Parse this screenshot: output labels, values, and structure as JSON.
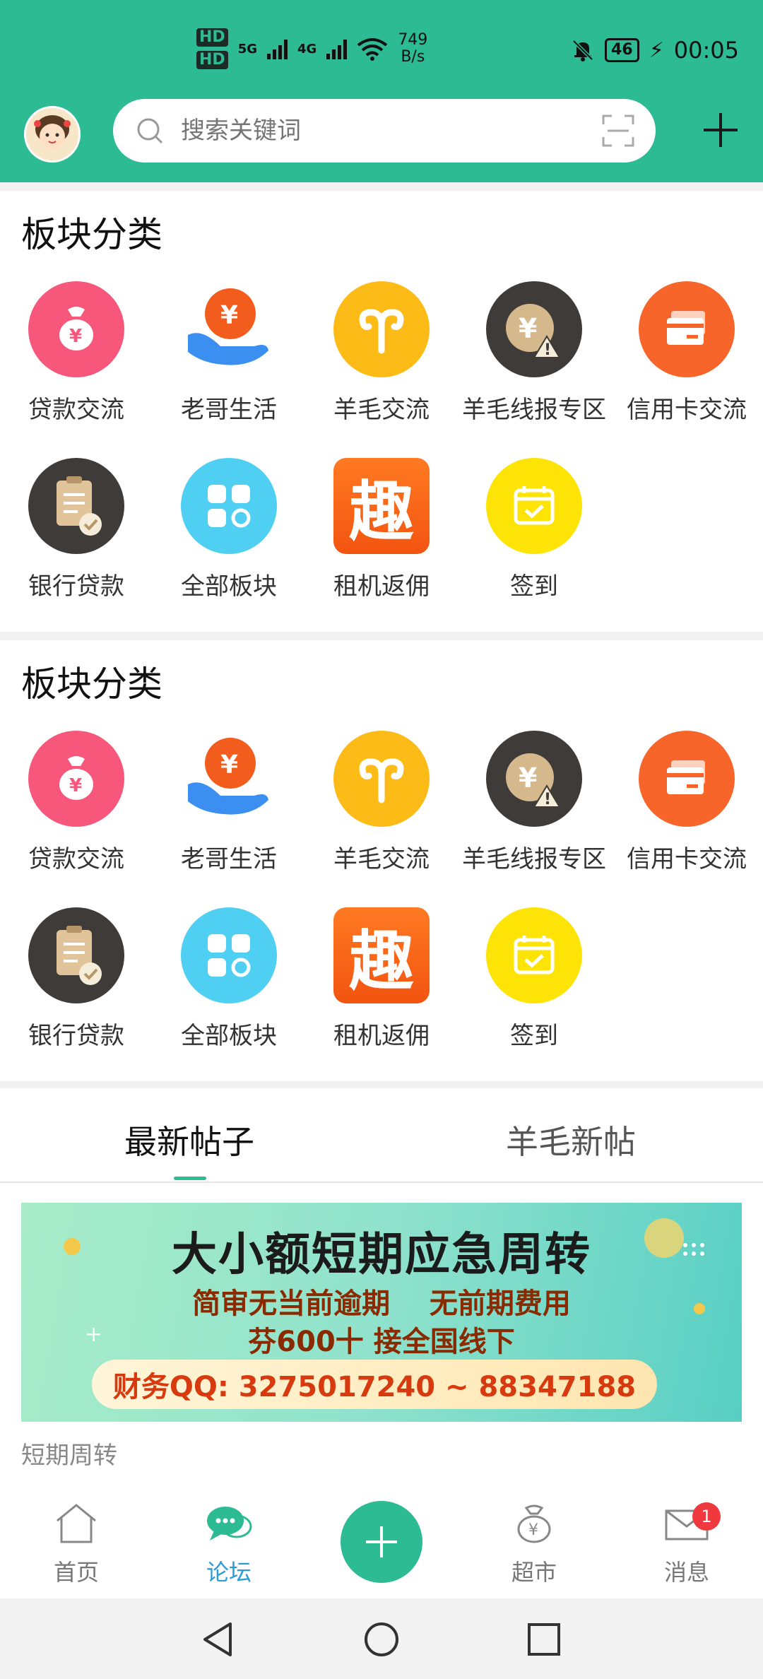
{
  "status_bar": {
    "hd1": "HD",
    "hd2": "HD",
    "net1": "5G",
    "net2": "4G",
    "speed_value": "749",
    "speed_unit": "B/s",
    "battery": "46",
    "time": "00:05"
  },
  "header": {
    "search_placeholder": "搜索关键词"
  },
  "sections": [
    {
      "title": "板块分类",
      "items": [
        {
          "label": "贷款交流",
          "icon": "money-bag-icon"
        },
        {
          "label": "老哥生活",
          "icon": "hand-coin-icon"
        },
        {
          "label": "羊毛交流",
          "icon": "aries-icon"
        },
        {
          "label": "羊毛线报专区",
          "icon": "coin-warning-icon"
        },
        {
          "label": "信用卡交流",
          "icon": "credit-card-icon"
        },
        {
          "label": "银行贷款",
          "icon": "clipboard-check-icon"
        },
        {
          "label": "全部板块",
          "icon": "all-blocks-icon"
        },
        {
          "label": "租机返佣",
          "icon": "qu-char-icon",
          "glyph": "趣"
        },
        {
          "label": "签到",
          "icon": "calendar-check-icon"
        }
      ]
    },
    {
      "title": "板块分类",
      "items": [
        {
          "label": "贷款交流",
          "icon": "money-bag-icon"
        },
        {
          "label": "老哥生活",
          "icon": "hand-coin-icon"
        },
        {
          "label": "羊毛交流",
          "icon": "aries-icon"
        },
        {
          "label": "羊毛线报专区",
          "icon": "coin-warning-icon"
        },
        {
          "label": "信用卡交流",
          "icon": "credit-card-icon"
        },
        {
          "label": "银行贷款",
          "icon": "clipboard-check-icon"
        },
        {
          "label": "全部板块",
          "icon": "all-blocks-icon"
        },
        {
          "label": "租机返佣",
          "icon": "qu-char-icon",
          "glyph": "趣"
        },
        {
          "label": "签到",
          "icon": "calendar-check-icon"
        }
      ]
    }
  ],
  "tabs": [
    {
      "label": "最新帖子",
      "active": true
    },
    {
      "label": "羊毛新帖",
      "active": false
    }
  ],
  "post": {
    "banner_line1": "大小额短期应急周转",
    "banner_line2": "简审无当前逾期    无前期费用",
    "banner_line3": "芬600十 接全国线下",
    "banner_contact": "财务QQ: 3275017240 ~ 88347188",
    "title": "短期周转"
  },
  "bottom_nav": [
    {
      "label": "首页",
      "icon": "home-icon",
      "active": false
    },
    {
      "label": "论坛",
      "icon": "forum-icon",
      "active": true
    },
    {
      "label": "超市",
      "icon": "shop-bag-icon",
      "active": false
    },
    {
      "label": "消息",
      "icon": "mail-icon",
      "active": false,
      "badge": "1"
    }
  ],
  "colors": {
    "brand": "#2dbb94",
    "badge": "#f0393f",
    "active_nav": "#2a9cd8"
  }
}
